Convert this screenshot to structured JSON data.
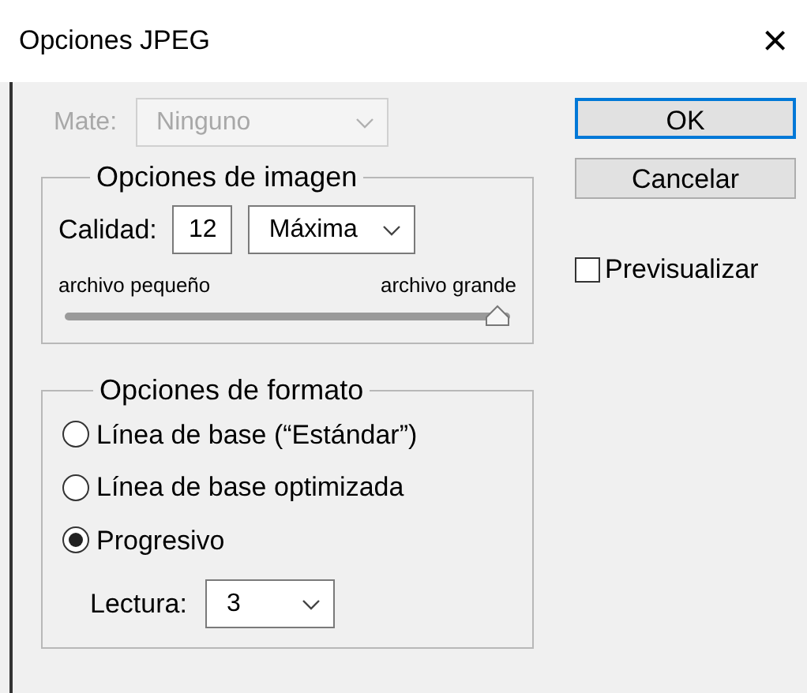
{
  "window": {
    "title": "Opciones JPEG",
    "close": "×"
  },
  "matte": {
    "label": "Mate:",
    "value": "Ninguno",
    "disabled": true
  },
  "buttons": [
    {
      "label": "OK",
      "default": true
    },
    {
      "label": "Cancelar",
      "default": false
    }
  ],
  "preview": {
    "label": "Previsualizar",
    "checked": false
  },
  "image_options": {
    "legend": "Opciones de imagen",
    "quality_label": "Calidad:",
    "quality_value": "12",
    "quality_preset": "Máxima",
    "small_label": "archivo pequeño",
    "large_label": "archivo grande",
    "level": 1
  },
  "format_options": {
    "legend": "Opciones de formato",
    "options": [
      {
        "label": "Línea de base (“Estándar”)",
        "selected": false
      },
      {
        "label": "Línea de base optimizada",
        "selected": false
      },
      {
        "label": "Progresivo",
        "selected": true
      }
    ],
    "scans_label": "Lectura:",
    "scans_value": "3"
  }
}
